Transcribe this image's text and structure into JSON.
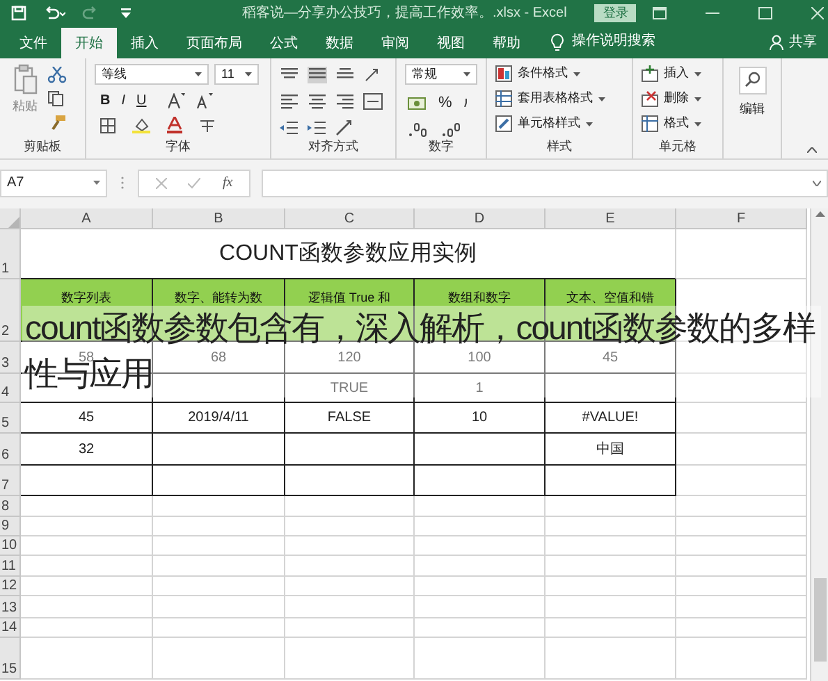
{
  "title_bar": {
    "title": "稻客说—分享办公技巧，提高工作效率。.xlsx  -  Excel",
    "login_button": "登录"
  },
  "ribbon_tabs": [
    {
      "label": "文件",
      "selected": false
    },
    {
      "label": "开始",
      "selected": true
    },
    {
      "label": "插入",
      "selected": false
    },
    {
      "label": "页面布局",
      "selected": false
    },
    {
      "label": "公式",
      "selected": false
    },
    {
      "label": "数据",
      "selected": false
    },
    {
      "label": "审阅",
      "selected": false
    },
    {
      "label": "视图",
      "selected": false
    },
    {
      "label": "帮助",
      "selected": false
    }
  ],
  "tell_me": "操作说明搜索",
  "share": "共享",
  "ribbon": {
    "clipboard": {
      "label": "剪贴板",
      "paste": "粘贴"
    },
    "font": {
      "label": "字体",
      "font_name": "等线",
      "font_size": "11",
      "bold": "B",
      "italic": "I",
      "underline": "U"
    },
    "alignment": {
      "label": "对齐方式"
    },
    "number": {
      "label": "数字",
      "format": "常规",
      "percent": "%"
    },
    "styles": {
      "label": "样式",
      "items": [
        "条件格式",
        "套用表格格式",
        "单元格样式"
      ]
    },
    "cells": {
      "label": "单元格",
      "items": [
        "插入",
        "删除",
        "格式"
      ]
    },
    "editing": {
      "label": "编辑"
    }
  },
  "formula_bar": {
    "name_box": "A7",
    "fx": "fx"
  },
  "sheet": {
    "columns": [
      "A",
      "B",
      "C",
      "D",
      "E",
      "F"
    ],
    "row_numbers": [
      "1",
      "2",
      "3",
      "4",
      "5",
      "6",
      "7",
      "8",
      "9",
      "10",
      "11",
      "12",
      "13",
      "14",
      "15"
    ],
    "title": "COUNT函数参数应用实例",
    "header_row": [
      "数字列表",
      "数字、能转为数",
      "逻辑值 True 和",
      "数组和数字",
      "文本、空值和错"
    ],
    "rows": [
      [
        "58",
        "68",
        "120",
        "100",
        "45"
      ],
      [
        null,
        null,
        "TRUE",
        "1",
        null
      ],
      [
        "45",
        "2019/4/11",
        "FALSE",
        "10",
        "#VALUE!"
      ],
      [
        "32",
        null,
        null,
        null,
        "中国"
      ],
      [
        null,
        null,
        null,
        null,
        null
      ]
    ]
  },
  "caption_overlay": "count函数参数包含有，深入解析，count函数参数的多样性与应用"
}
